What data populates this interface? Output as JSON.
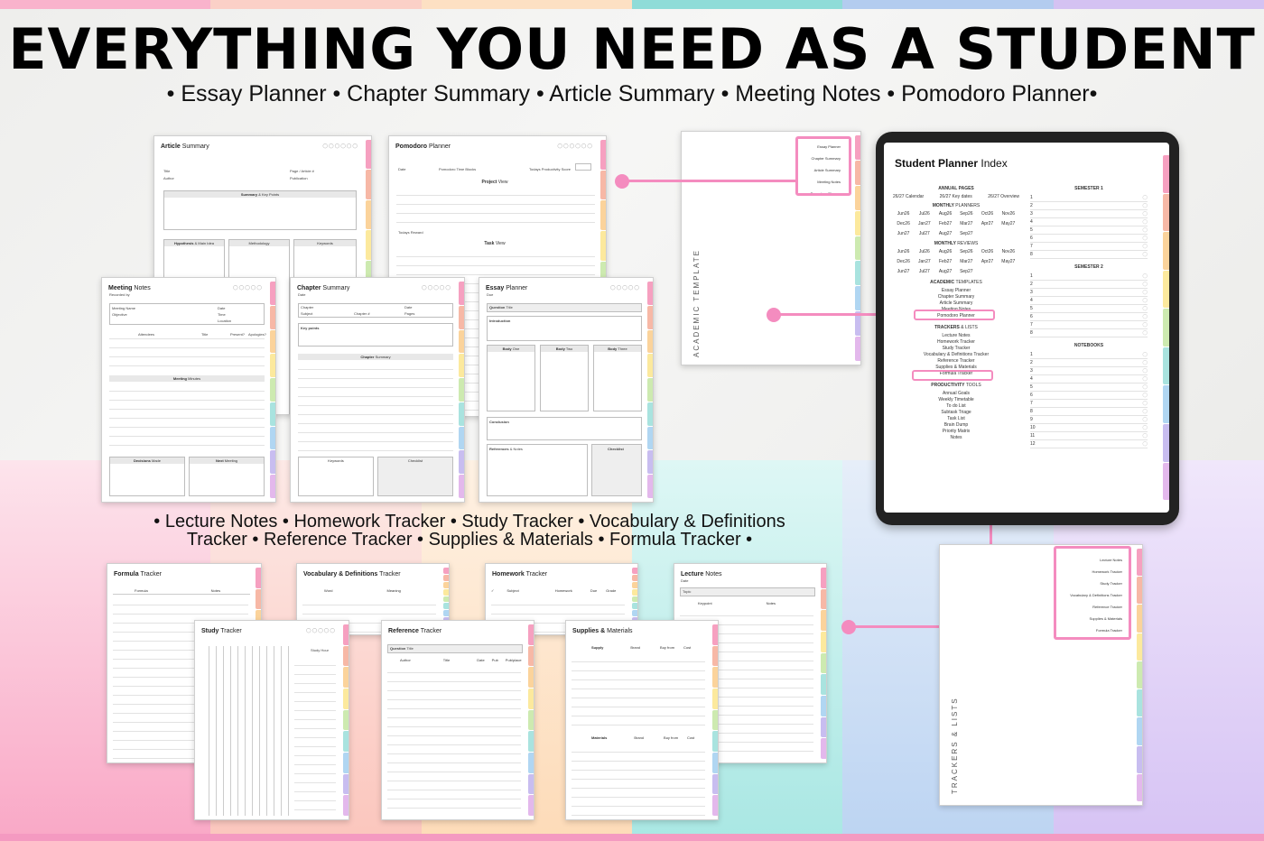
{
  "headline": "EVERYTHING YOU NEED AS A STUDENT",
  "subtitle_top": "• Essay Planner • Chapter Summary • Article Summary • Meeting Notes • Pomodoro Planner•",
  "subtitle_bottom_1": "• Lecture Notes • Homework Tracker • Study Tracker • Vocabulary & Definitions",
  "subtitle_bottom_2": "Tracker • Reference Tracker • Supplies & Materials • Formula Tracker •",
  "colors": {
    "pink": "#f48cbf",
    "stripes": [
      "#f9b3cc",
      "#fbd0c7",
      "#fde0c3",
      "#b9ecea",
      "#c6dcf4",
      "#dccbf5"
    ],
    "tabs": [
      "#f6a0c0",
      "#f7b8a6",
      "#fbd39b",
      "#fce99d",
      "#cdeab0",
      "#a9e3df",
      "#b0d6f2",
      "#c8bdf0",
      "#e3b8ec"
    ]
  },
  "pages": {
    "article_summary": {
      "title": "Article",
      "title2": "Summary",
      "f1": "Title",
      "f2": "Author",
      "f3": "Page / Article #",
      "f4": "Publication",
      "s1": "Summary",
      "s1b": "& Key Points",
      "s2": "Hypothesis",
      "s2b": "& Main Idea",
      "s3": "Methodology",
      "s4": "Keywords"
    },
    "pomodoro": {
      "title": "Pomodoro",
      "title2": "Planner",
      "f1": "Date",
      "f2": "Pomodoro Time Blocks",
      "f3": "Todays Productivity Score",
      "s1": "Project",
      "s1b": "View",
      "c1": "#",
      "c2": "Projects",
      "c3": "Target",
      "c4": "Actual",
      "c5": "Time",
      "c6": "✓",
      "reward": "Todays Reward",
      "s2": "Task",
      "s2b": "View",
      "t1": "#",
      "t2": "Task/Activity",
      "t3": "Start",
      "t4": "End",
      "t5": "✓"
    },
    "meeting_notes": {
      "title": "Meeting",
      "title2": "Notes",
      "sub": "Recorded by",
      "f1": "Meeting Name",
      "f2": "Objective",
      "f3": "Date",
      "f4": "Time",
      "f5": "Location",
      "c1": "Attendees",
      "c2": "Title",
      "c3": "Present?",
      "c4": "Apologies?",
      "s1": "Meeting",
      "s1b": "Minutes",
      "s2": "Decisions",
      "s2b": "Made",
      "s3": "Next",
      "s3b": "Meeting"
    },
    "chapter_summary": {
      "title": "Chapter",
      "title2": "Summary",
      "sub": "Date",
      "f1": "Chapter",
      "f2": "Subject",
      "f3": "Chapter #",
      "f4": "Date",
      "f5": "Pages",
      "s1": "Key points",
      "s2": "Chapter",
      "s2b": "Summary",
      "s3": "Keywords",
      "s4": "Checklist"
    },
    "essay_planner": {
      "title": "Essay",
      "title2": "Planner",
      "sub": "Due",
      "s1": "Question",
      "s1b": "Title",
      "s2": "Introduction",
      "s3": "Body",
      "s3b": "One",
      "s4": "Body",
      "s4b": "Two",
      "s5": "Body",
      "s5b": "Three",
      "s6": "Conclusion",
      "s7": "References",
      "s7b": "& Notes",
      "s8": "Checklist"
    },
    "formula_tracker": {
      "title": "Formula",
      "title2": "Tracker",
      "c1": "Formula",
      "c2": "Notes"
    },
    "vocab": {
      "title": "Vocabulary & Definitions",
      "title2": "Tracker",
      "c1": "Word",
      "c2": "Meaning"
    },
    "homework": {
      "title": "Homework",
      "title2": "Tracker",
      "c1": "✓",
      "c2": "Subject",
      "c3": "Homework",
      "c4": "Due",
      "c5": "Grade"
    },
    "lecture": {
      "title": "Lecture",
      "title2": "Notes",
      "sub": "Date",
      "f1": "Topic",
      "c1": "Keypoint",
      "c2": "Notes"
    },
    "study": {
      "title": "Study",
      "title2": "Tracker",
      "c1": "Study Hour"
    },
    "reference": {
      "title": "Reference",
      "title2": "Tracker",
      "f1": "Question",
      "f1b": "Title",
      "c1": "Author",
      "c2": "Title",
      "c3": "Date",
      "c4": "Pub",
      "c5": "Pub/place"
    },
    "supplies": {
      "title": "Supplies &",
      "title2": "Materials",
      "c1": "Supply",
      "c2": "Brand",
      "c3": "Buy from",
      "c4": "Cost",
      "d1": "Materials",
      "d2": "Brand",
      "d3": "Buy from",
      "d4": "Cost"
    }
  },
  "academic": {
    "vertical": "ACADEMIC TEMPLATE",
    "items": [
      "Essay Planner",
      "Chapter Summary",
      "Article Summary",
      "Meeting Notes",
      "Pomodoro Planner"
    ]
  },
  "trackers": {
    "vertical": "TRACKERS & LISTS",
    "items": [
      "Lecture Notes",
      "Homework Tracker",
      "Study Tracker",
      "Vocabulary & Definitions Tracker",
      "Reference Tracker",
      "Supplies & Materials",
      "Formula Tracker"
    ]
  },
  "index": {
    "title": "Student Planner",
    "title2": "Index",
    "annual": "ANNUAL PAGES",
    "annual_row": [
      "26/27 Calendar",
      "26/27 Key dates",
      "26/27 Overview"
    ],
    "monthly_planners": "MONTHLY",
    "monthly_planners2": "PLANNERS",
    "months_rows": [
      [
        "Jun26",
        "Jul26",
        "Aug26",
        "Sep26",
        "Oct26",
        "Nov26"
      ],
      [
        "Dec26",
        "Jan27",
        "Feb27",
        "Mar27",
        "Apr27",
        "May27"
      ],
      [
        "Jun27",
        "Jul27",
        "Aug27",
        "Sep27"
      ]
    ],
    "monthly_reviews": "MONTHLY",
    "monthly_reviews2": "REVIEWS",
    "academic_h": "ACADEMIC",
    "academic_h2": "TEMPLATES",
    "academic_items": [
      "Essay Planner",
      "Chapter Summary",
      "Article Summary",
      "Meeting Notes",
      "Pomodoro Planner"
    ],
    "trackers_h": "TRACKERS",
    "trackers_h2": "& LISTS",
    "trackers_items": [
      "Lecture Notes",
      "Homework Tracker",
      "Study Tracker",
      "Vocabulary & Definitions Tracker",
      "Reference Tracker",
      "Supplies & Materials",
      "Formula Tracker"
    ],
    "productivity_h": "PRODUCTIVITY",
    "productivity_h2": "TOOLS",
    "productivity_items": [
      "Annual Goals",
      "Weekly Timetable",
      "To do List",
      "Subtask Triage",
      "Task List",
      "Brain Dump",
      "Priority Matrix",
      "Notes"
    ],
    "sem1": "SEMESTER 1",
    "sem2": "SEMESTER 2",
    "notebooks": "NOTEBOOKS",
    "sem1_nums": [
      "1",
      "2",
      "3",
      "4",
      "5",
      "6",
      "7",
      "8"
    ],
    "sem2_nums": [
      "1",
      "2",
      "3",
      "4",
      "5",
      "6",
      "7",
      "8"
    ],
    "nb_nums": [
      "1",
      "2",
      "3",
      "4",
      "5",
      "6",
      "7",
      "8",
      "9",
      "10",
      "11",
      "12"
    ]
  }
}
